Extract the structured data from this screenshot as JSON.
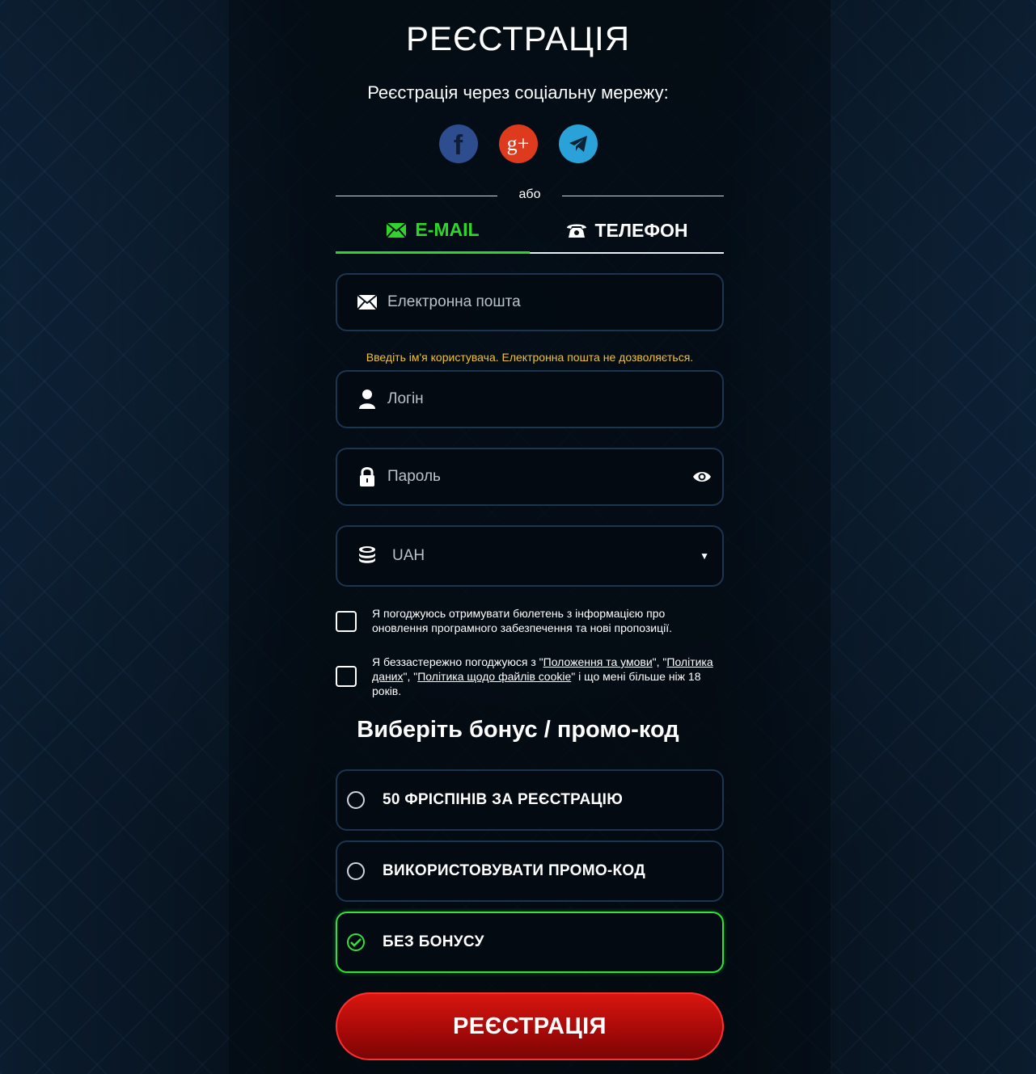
{
  "header": {
    "title": "РЕЄСТРАЦІЯ",
    "social_prompt": "Реєстрація через соціальну мережу:"
  },
  "social": {
    "facebook_glyph": "f",
    "google_glyph": "g+"
  },
  "divider_text": "або",
  "tabs": [
    {
      "label": "E-MAIL",
      "icon": "envelope-icon",
      "active": true
    },
    {
      "label": "ТЕЛЕФОН",
      "icon": "phone-icon",
      "active": false
    }
  ],
  "form": {
    "email_placeholder": "Електронна пошта",
    "username_hint": "Введіть ім'я користувача. Електронна пошта не дозволяється.",
    "login_placeholder": "Логін",
    "password_placeholder": "Пароль",
    "currency_value": "UAH",
    "newsletter_text": "Я погоджуюсь отримувати бюлетень з інформацією про оновлення програмного забезпечення та нові пропозиції.",
    "terms": {
      "part1": "Я беззастережно погоджуюся з \"",
      "link1": "Положення та умови",
      "part2": "\", \"",
      "link2": "Політика даних",
      "part3": "\", \"",
      "link3": "Політика щодо файлів cookie",
      "part4": "\" і що мені більше ніж 18 років."
    }
  },
  "bonus": {
    "title": "Виберіть бонус / промо-код",
    "options": [
      {
        "label": "50 ФРІСПІНІВ ЗА РЕЄСТРАЦІЮ",
        "selected": false
      },
      {
        "label": "ВИКОРИСТОВУВАТИ ПРОМО-КОД",
        "selected": false
      },
      {
        "label": "БЕЗ БОНУСУ",
        "selected": true
      }
    ]
  },
  "submit_label": "РЕЄСТРАЦІЯ",
  "colors": {
    "accent_green": "#2fd52b",
    "hint_yellow": "#f2c230",
    "button_red": "#c8100c",
    "facebook": "#2d4d8f",
    "google": "#dd3a1e",
    "telegram": "#2aa1d9"
  }
}
